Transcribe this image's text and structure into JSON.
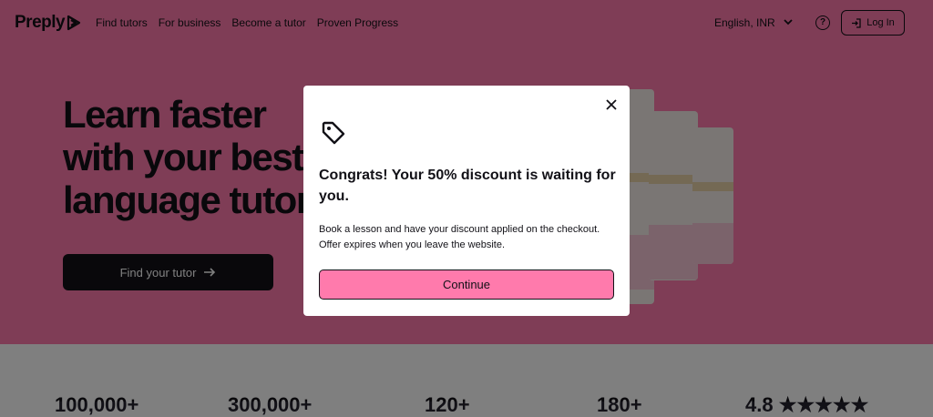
{
  "nav": {
    "logo": "Preply",
    "links": [
      "Find tutors",
      "For business",
      "Become a tutor",
      "Proven Progress"
    ],
    "language": "English, INR",
    "help_icon": "question-icon",
    "login_label": "Log In"
  },
  "hero": {
    "headline_lines": [
      "Learn faster",
      "with your best",
      "language tutor"
    ],
    "cta_label": "Find your tutor",
    "background_color": "#ff7aac"
  },
  "stats": [
    "100,000+",
    "300,000+",
    "120+",
    "180+",
    "4.8 ★★★★★"
  ],
  "modal": {
    "title": "Congrats! Your 50% discount is waiting for you.",
    "body": "Book a lesson and have your discount applied on the checkout. Offer expires when you leave the website.",
    "continue_label": "Continue",
    "accent_color": "#ff7aac"
  }
}
